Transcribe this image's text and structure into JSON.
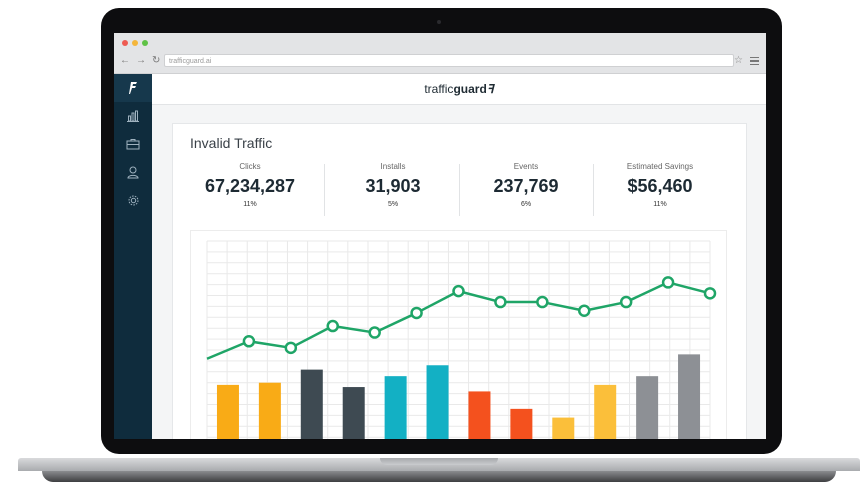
{
  "browser": {
    "url": "trafficguard.ai",
    "traffic_lights": [
      "#ee5b52",
      "#f4b63b",
      "#5fc246"
    ],
    "back_icon": "back-arrow-icon",
    "forward_icon": "forward-arrow-icon",
    "reload_icon": "reload-icon",
    "bookmark_icon": "star-icon",
    "menu_icon": "hamburger-menu-icon"
  },
  "sidebar": {
    "background": "#0f2c3d",
    "items": [
      {
        "icon": "trafficguard-logo-icon"
      },
      {
        "icon": "bar-chart-icon"
      },
      {
        "icon": "briefcase-icon"
      },
      {
        "icon": "user-icon"
      },
      {
        "icon": "gear-icon"
      }
    ]
  },
  "header": {
    "logo_text_light": "traffic",
    "logo_text_bold": "guard",
    "logo_mark": "ꟻ"
  },
  "panel": {
    "title": "Invalid Traffic",
    "metrics": [
      {
        "label": "Clicks",
        "value": "67,234,287",
        "percent": "11%"
      },
      {
        "label": "Installs",
        "value": "31,903",
        "percent": "5%"
      },
      {
        "label": "Events",
        "value": "237,769",
        "percent": "6%"
      },
      {
        "label": "Estimated Savings",
        "value": "$56,460",
        "percent": "11%"
      }
    ]
  },
  "chart_data": {
    "type": "bar",
    "ylim": [
      0,
      100
    ],
    "grid": true,
    "series": [
      {
        "type": "bar",
        "values": [
          34,
          35,
          41,
          33,
          38,
          43,
          31,
          23,
          19,
          34,
          38,
          48
        ],
        "colors": [
          "#f9ab16",
          "#f9ab16",
          "#3e4a52",
          "#3e4a52",
          "#13b0c4",
          "#13b0c4",
          "#f4511e",
          "#f4511e",
          "#fbbf3a",
          "#fbbf3a",
          "#8d9095",
          "#8d9095"
        ]
      },
      {
        "type": "line",
        "color": "#1fa567",
        "values": [
          46,
          54,
          51,
          61,
          58,
          67,
          77,
          72,
          72,
          68,
          72,
          81,
          76
        ]
      }
    ]
  }
}
